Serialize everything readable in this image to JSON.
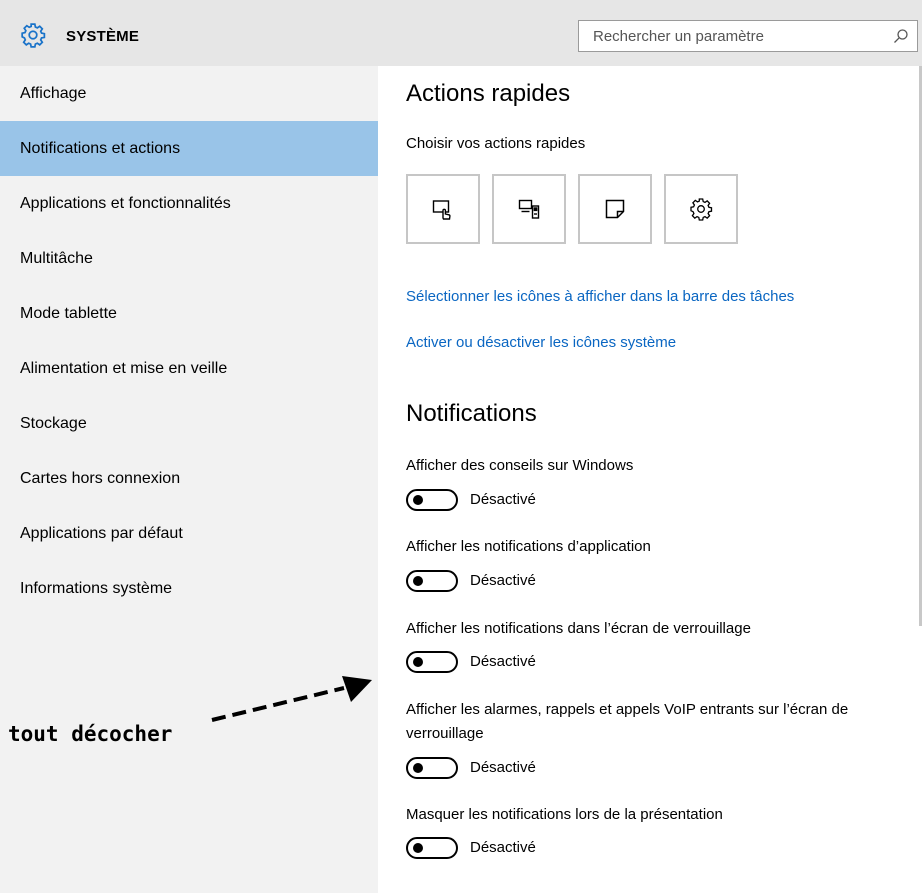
{
  "header": {
    "app_icon": "gear-icon",
    "title": "SYSTÈME",
    "search_placeholder": "Rechercher un paramètre",
    "search_icon": "search-icon"
  },
  "sidebar": {
    "items": [
      {
        "label": "Affichage",
        "selected": false
      },
      {
        "label": "Notifications et actions",
        "selected": true
      },
      {
        "label": "Applications et fonctionnalités",
        "selected": false
      },
      {
        "label": "Multitâche",
        "selected": false
      },
      {
        "label": "Mode tablette",
        "selected": false
      },
      {
        "label": "Alimentation et mise en veille",
        "selected": false
      },
      {
        "label": "Stockage",
        "selected": false
      },
      {
        "label": "Cartes hors connexion",
        "selected": false
      },
      {
        "label": "Applications par défaut",
        "selected": false
      },
      {
        "label": "Informations système",
        "selected": false
      }
    ]
  },
  "main": {
    "quick_actions": {
      "title": "Actions rapides",
      "subtitle": "Choisir vos actions rapides",
      "tiles": [
        {
          "icon": "tablet-mode-icon"
        },
        {
          "icon": "connect-icon"
        },
        {
          "icon": "note-icon"
        },
        {
          "icon": "settings-gear-icon"
        }
      ]
    },
    "links": [
      "Sélectionner les icônes à afficher dans la barre des tâches",
      "Activer ou désactiver les icônes système"
    ],
    "notifications": {
      "title": "Notifications",
      "settings": [
        {
          "label": "Afficher des conseils sur Windows",
          "state": "Désactivé",
          "on": false
        },
        {
          "label": "Afficher les notifications d’application",
          "state": "Désactivé",
          "on": false
        },
        {
          "label": "Afficher les notifications dans l’écran de verrouillage",
          "state": "Désactivé",
          "on": false
        },
        {
          "label": "Afficher les alarmes, rappels et appels VoIP entrants sur l’écran de verrouillage",
          "state": "Désactivé",
          "on": false
        },
        {
          "label": "Masquer les notifications lors de la présentation",
          "state": "Désactivé",
          "on": false
        }
      ]
    }
  },
  "annotation": {
    "text": "tout décocher"
  },
  "colors": {
    "selected_nav": "#99c4e8",
    "link": "#0a66c2",
    "titlebar": "#e6e6e6",
    "sidebar": "#f2f2f2"
  }
}
